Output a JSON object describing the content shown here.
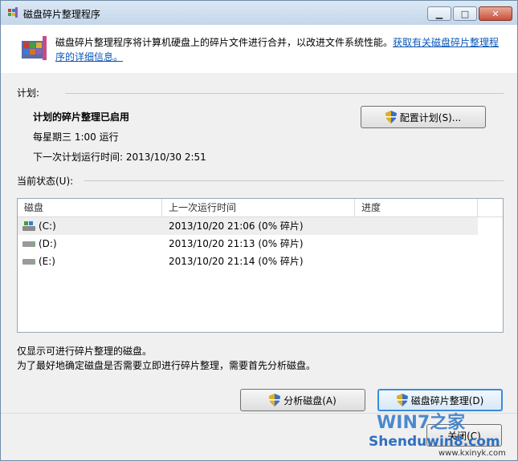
{
  "window": {
    "title": "磁盘碎片整理程序",
    "minimize_icon": "minimize-icon",
    "maximize_icon": "maximize-icon",
    "close_icon": "close-icon"
  },
  "info": {
    "text": "磁盘碎片整理程序将计算机硬盘上的碎片文件进行合并，以改进文件系统性能。",
    "link": "获取有关磁盘碎片整理程序的详细信息。"
  },
  "schedule": {
    "section_label": "计划:",
    "status": "计划的碎片整理已启用",
    "frequency": "每星期三  1:00 运行",
    "next_run": "下一次计划运行时间: 2013/10/30 2:51",
    "configure_button": "配置计划(S)..."
  },
  "current_status": {
    "section_label": "当前状态(U):",
    "columns": [
      "磁盘",
      "上一次运行时间",
      "进度"
    ],
    "disks": [
      {
        "name": "(C:)",
        "last_run": "2013/10/20 21:06 (0% 碎片)",
        "progress": "",
        "icon": "system-drive-icon"
      },
      {
        "name": "(D:)",
        "last_run": "2013/10/20 21:13 (0% 碎片)",
        "progress": "",
        "icon": "hard-drive-icon"
      },
      {
        "name": "(E:)",
        "last_run": "2013/10/20 21:14 (0% 碎片)",
        "progress": "",
        "icon": "hard-drive-icon"
      }
    ]
  },
  "notes": {
    "line1": "仅显示可进行碎片整理的磁盘。",
    "line2": "为了最好地确定磁盘是否需要立即进行碎片整理，需要首先分析磁盘。"
  },
  "buttons": {
    "analyze": "分析磁盘(A)",
    "defragment": "磁盘碎片整理(D)",
    "close": "关闭(C)"
  },
  "watermark": {
    "line1": "WIN7之家",
    "line2": "Shenduwin8.com",
    "line3": "www.kxinyk.com"
  },
  "colors": {
    "link": "#0b57b8",
    "focus_border": "#3c8bd8",
    "title_bar": "#c4d6ea"
  }
}
